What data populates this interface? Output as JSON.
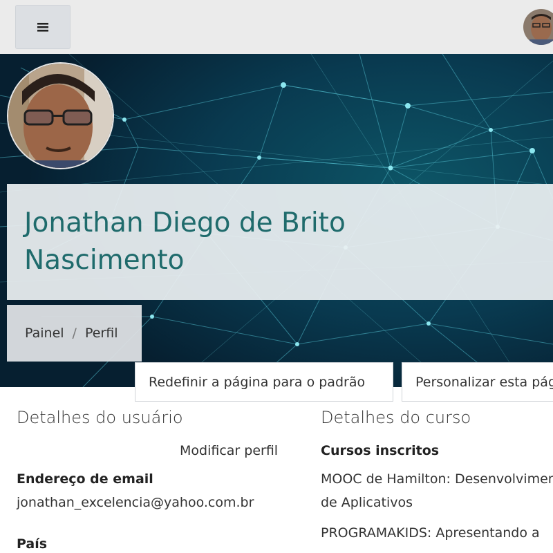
{
  "topbar": {
    "menu_icon": "hamburger-icon",
    "avatar_icon": "user-avatar"
  },
  "profile": {
    "name": "Jonathan Diego de Brito Nascimento",
    "avatar": "profile-photo"
  },
  "breadcrumb": {
    "items": [
      "Painel",
      "Perfil"
    ],
    "separator": "/"
  },
  "buttons": {
    "reset": "Redefinir a página para o padrão",
    "customize": "Personalizar esta página"
  },
  "user_details": {
    "title": "Detalhes do usuário",
    "edit_link": "Modificar perfil",
    "email_label": "Endereço de email",
    "email_value": "jonathan_excelencia@yahoo.com.br",
    "country_label": "País"
  },
  "course_details": {
    "title": "Detalhes do curso",
    "enrolled_label": "Cursos inscritos",
    "courses": [
      {
        "line1": "MOOC de Hamilton: Desenvolvimento",
        "line2": "de Aplicativos"
      },
      {
        "line1": "PROGRAMAKIDS: Apresentando a"
      }
    ]
  },
  "colors": {
    "accent": "#1f6b6c",
    "banner": "#07283a",
    "topbar": "#ebebeb"
  }
}
